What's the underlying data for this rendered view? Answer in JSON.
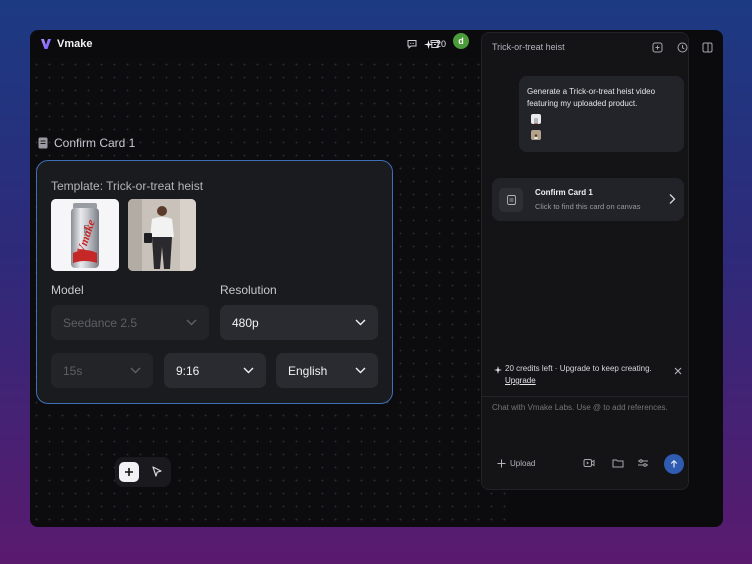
{
  "app": {
    "name": "Vmake"
  },
  "topbar": {
    "credits": "20",
    "avatar_initial": "d"
  },
  "card": {
    "label": "Confirm Card 1",
    "template_title": "Template: Trick-or-treat heist",
    "thumb1_text": "Vmake",
    "thumb1_small": "Labs",
    "model": {
      "label": "Model",
      "value": "Seedance 2.5"
    },
    "resolution": {
      "label": "Resolution",
      "value": "480p"
    },
    "duration": {
      "value": "15s"
    },
    "aspect": {
      "value": "9:16"
    },
    "language": {
      "value": "English"
    }
  },
  "panel": {
    "title": "Trick-or-treat heist",
    "message": "Generate a Trick-or-treat heist video featuring my uploaded product.",
    "confirm": {
      "title": "Confirm Card 1",
      "subtitle": "Click to find this card on canvas"
    },
    "upsell": {
      "text": "20 credits left · Upgrade to keep creating.",
      "link": "Upgrade"
    },
    "input_placeholder": "Chat with Vmake Labs. Use @ to add references.",
    "upload_label": "Upload"
  },
  "colors": {
    "accent": "#3f6fb6",
    "send": "#2f5bb0",
    "avatar": "#4a9d3a"
  }
}
